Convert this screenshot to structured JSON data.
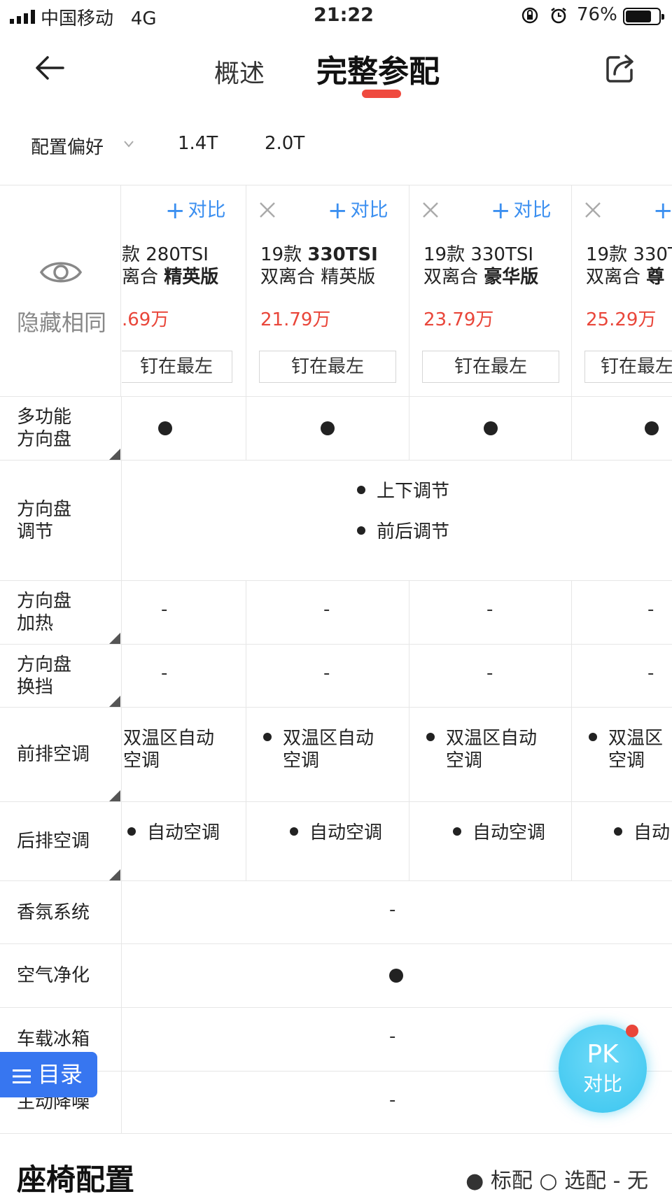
{
  "status": {
    "carrier": "中国移动",
    "network": "4G",
    "time": "21:22",
    "battery": "76%",
    "battery_level": 0.76
  },
  "nav": {
    "tab_overview": "概述",
    "tab_full_config": "完整参配",
    "active_color": "#ef4a3f"
  },
  "filters": {
    "preference": "配置偏好",
    "opt1": "1.4T",
    "opt2": "2.0T"
  },
  "header": {
    "hide_same": "隐藏相同",
    "compare": "对比",
    "pin": "钉在最左",
    "compare_color": "#3b8ff0",
    "price_color": "#e9463a"
  },
  "models": [
    {
      "name_line1": "款 280TSI",
      "name_line2_prefix": "离合 ",
      "name_line2_bold": "精英版",
      "price": ".69万"
    },
    {
      "name_line1_prefix": "19款 ",
      "name_line1_bold": "330TSI",
      "name_line2": "双离合 精英版",
      "price": "21.79万"
    },
    {
      "name_line1": "19款 330TSI",
      "name_line2_prefix": "双离合 ",
      "name_line2_bold": "豪华版",
      "price": "23.79万"
    },
    {
      "name_line1": "19款 330T",
      "name_line2_prefix": "双离合 ",
      "name_line2_bold": "尊",
      "price": "25.29万"
    }
  ],
  "rows": {
    "multi_wheel": {
      "l1": "多功能",
      "l2": "方向盘"
    },
    "wheel_adjust": {
      "l1": "方向盘",
      "l2": "调节",
      "v1": "上下调节",
      "v2": "前后调节"
    },
    "wheel_heat": {
      "l1": "方向盘",
      "l2": "加热",
      "dash": "-"
    },
    "wheel_shift": {
      "l1": "方向盘",
      "l2": "换挡",
      "dash": "-"
    },
    "front_ac": {
      "label": "前排空调",
      "v_line1": "双温区自动",
      "v_line2": "空调",
      "v4_line1": "双温区",
      "v4_line2": "空调"
    },
    "rear_ac": {
      "label": "后排空调",
      "value": "自动空调",
      "v4": "自动"
    },
    "fragrance": {
      "label": "香氛系统",
      "dash": "-"
    },
    "air_purify": {
      "label": "空气净化"
    },
    "fridge": {
      "label": "车载冰箱",
      "dash": "-"
    },
    "noise_cancel": {
      "label": "主动降噪",
      "dash": "-"
    }
  },
  "section": {
    "title": "座椅配置",
    "legend": "● 标配  ○ 选配  - 无"
  },
  "toc": {
    "label": "目录",
    "color": "#3776f0"
  },
  "pk": {
    "line1": "PK",
    "line2": "对比"
  }
}
